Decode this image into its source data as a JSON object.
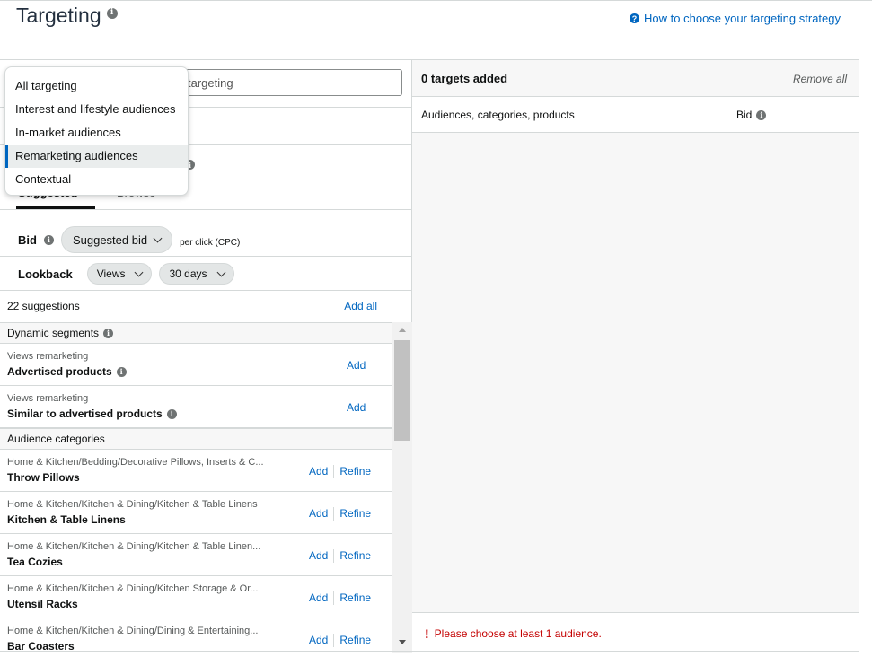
{
  "header": {
    "title": "Targeting",
    "help_link": "How to choose your targeting strategy"
  },
  "search": {
    "visible_text": "targeting"
  },
  "dropdown": {
    "items": [
      {
        "label": "All targeting"
      },
      {
        "label": "Interest and lifestyle audiences"
      },
      {
        "label": "In-market audiences"
      },
      {
        "label": "Remarketing audiences",
        "selected": true
      },
      {
        "label": "Contextual"
      }
    ]
  },
  "tabs": {
    "suggested": "Suggested",
    "browse": "Browse"
  },
  "bid": {
    "label": "Bid",
    "select_value": "Suggested bid",
    "unit": "per click (CPC)"
  },
  "lookback": {
    "label": "Lookback",
    "type_value": "Views",
    "period_value": "30 days"
  },
  "suggestions": {
    "count_label": "22 suggestions",
    "add_all": "Add all",
    "add_label": "Add",
    "refine_label": "Refine",
    "sections": [
      {
        "title": "Dynamic segments",
        "items": [
          {
            "sub": "Views remarketing",
            "name": "Advertised products"
          },
          {
            "sub": "Views remarketing",
            "name": "Similar to advertised products"
          }
        ]
      },
      {
        "title": "Audience categories",
        "items": [
          {
            "sub": "Home & Kitchen/Bedding/Decorative Pillows, Inserts & C...",
            "name": "Throw Pillows"
          },
          {
            "sub": "Home & Kitchen/Kitchen & Dining/Kitchen & Table Linens",
            "name": "Kitchen & Table Linens"
          },
          {
            "sub": "Home & Kitchen/Kitchen & Dining/Kitchen & Table Linen...",
            "name": "Tea Cozies"
          },
          {
            "sub": "Home & Kitchen/Kitchen & Dining/Kitchen Storage & Or...",
            "name": "Utensil Racks"
          },
          {
            "sub": "Home & Kitchen/Kitchen & Dining/Dining & Entertaining...",
            "name": "Bar Coasters"
          }
        ]
      }
    ]
  },
  "targets_panel": {
    "added_label": "0 targets added",
    "remove_all": "Remove all",
    "col_targets": "Audiences, categories, products",
    "col_bid": "Bid",
    "error": "Please choose at least 1 audience."
  },
  "colors": {
    "link": "#0066c0",
    "error": "#c40000",
    "selected_accent": "#0066c0"
  }
}
